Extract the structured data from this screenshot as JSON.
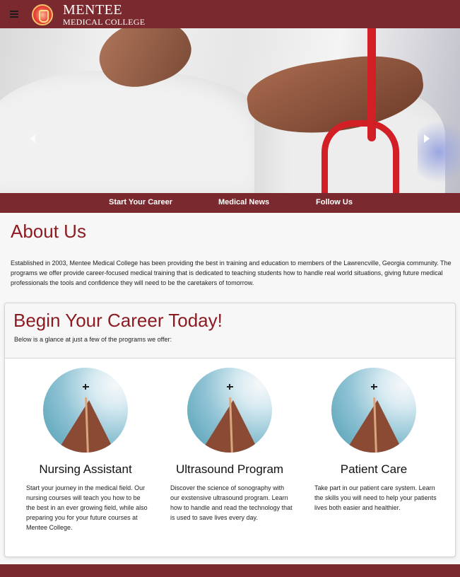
{
  "header": {
    "logo_line1": "MENTEE",
    "logo_line2": "MEDICAL COLLEGE"
  },
  "hero": {
    "prev_icon": "chevron-left-icon",
    "next_icon": "chevron-right-icon"
  },
  "subnav": {
    "items": [
      "Start Your Career",
      "Medical News",
      "Follow Us"
    ]
  },
  "about": {
    "title": "About Us",
    "text": "Established in 2003, Mentee Medical College has been providing the best in training and education to members of the Lawrencville, Georgia community. The programs we offer provide career-focused medical training that is dedicated to teaching students how to handle real world situations, giving future medical professionals the tools and confidence they will need to be the caretakers of tomorrow."
  },
  "career": {
    "title": "Begin Your Career Today!",
    "subtitle": "Below is a glance at just a few of the programs we offer:",
    "programs": [
      {
        "title": "Nursing Assistant",
        "text": "Start your journey in the medical field. Our nursing courses will teach you how to be the best in an ever growing field, while also preparing you for your future courses at Mentee College."
      },
      {
        "title": "Ultrasound Program",
        "text": "Discover the science of sonography with our exstensive ultrasound program. Learn how to handle and read the technology that is used to save lives every day."
      },
      {
        "title": "Patient Care",
        "text": "Take part in our patient care system. Learn the skills you will need to help your patients lives both easier and healthier."
      }
    ]
  },
  "colors": {
    "brand": "#7a2a2e",
    "heading": "#8c1c22"
  }
}
